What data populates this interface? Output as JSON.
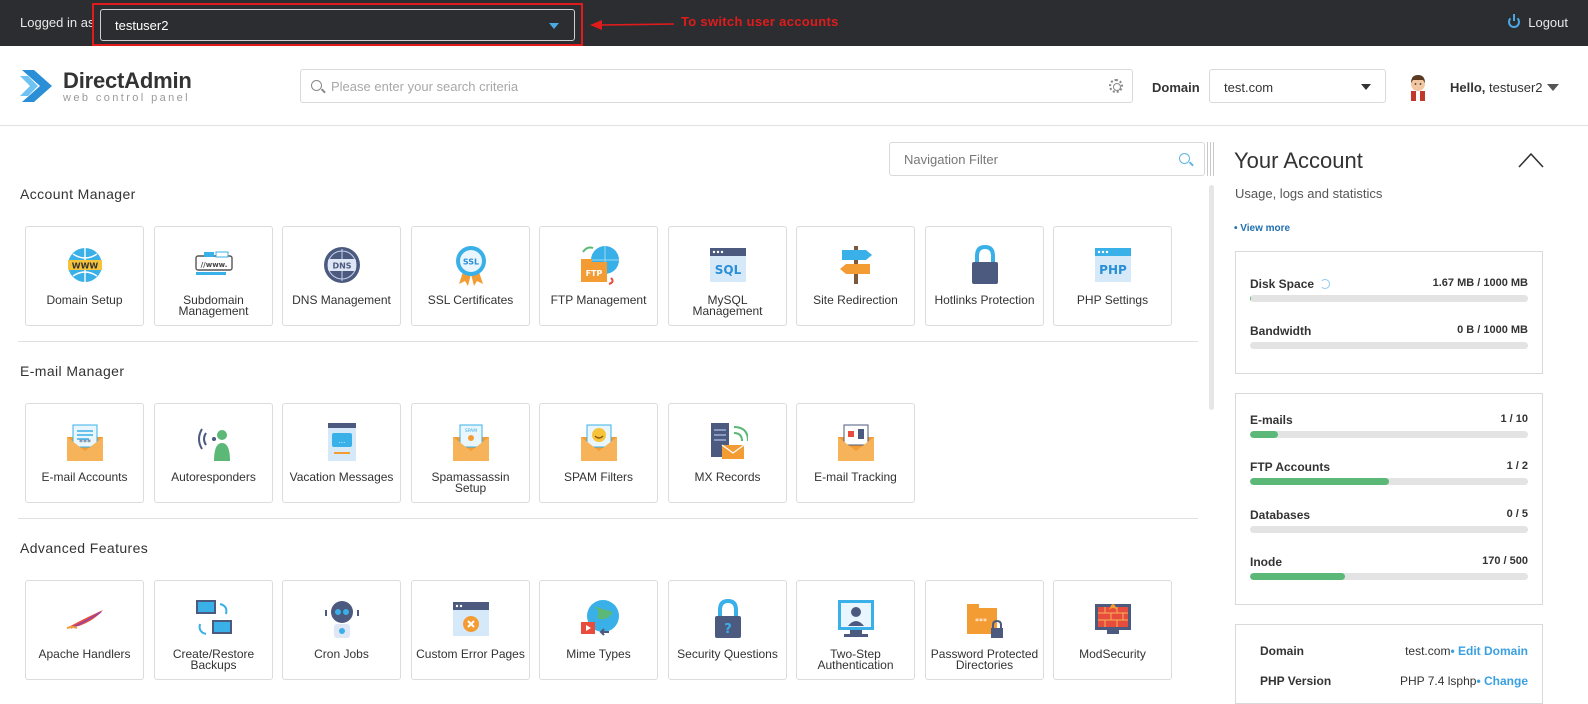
{
  "topbar": {
    "logged_in_as": "Logged in as",
    "user_select": "testuser2",
    "annotation": "To switch user accounts",
    "logout": "Logout"
  },
  "header": {
    "logo_title": "DirectAdmin",
    "logo_sub": "web control panel",
    "search_placeholder": "Please enter your search criteria",
    "domain_label": "Domain",
    "domain_value": "test.com",
    "hello_prefix": "Hello,",
    "hello_user": "testuser2"
  },
  "main": {
    "nav_filter_placeholder": "Navigation Filter",
    "sections": [
      {
        "title": "Account Manager",
        "tiles": [
          {
            "label": "Domain Setup",
            "icon": "www-globe-icon"
          },
          {
            "label": "Subdomain Management",
            "icon": "subdomain-icon"
          },
          {
            "label": "DNS Management",
            "icon": "dns-globe-icon"
          },
          {
            "label": "SSL Certificates",
            "icon": "ssl-badge-icon"
          },
          {
            "label": "FTP Management",
            "icon": "ftp-folder-icon"
          },
          {
            "label": "MySQL Management",
            "icon": "sql-window-icon"
          },
          {
            "label": "Site Redirection",
            "icon": "signpost-icon"
          },
          {
            "label": "Hotlinks Protection",
            "icon": "padlock-icon"
          },
          {
            "label": "PHP Settings",
            "icon": "php-window-icon"
          }
        ]
      },
      {
        "title": "E-mail Manager",
        "tiles": [
          {
            "label": "E-mail Accounts",
            "icon": "envelope-list-icon"
          },
          {
            "label": "Autoresponders",
            "icon": "broadcast-person-icon"
          },
          {
            "label": "Vacation Messages",
            "icon": "chat-document-icon"
          },
          {
            "label": "Spamassassin Setup",
            "icon": "spam-envelope-icon"
          },
          {
            "label": "SPAM Filters",
            "icon": "smiley-envelope-icon"
          },
          {
            "label": "MX Records",
            "icon": "mail-server-icon"
          },
          {
            "label": "E-mail Tracking",
            "icon": "tracking-envelope-icon"
          }
        ]
      },
      {
        "title": "Advanced Features",
        "tiles": [
          {
            "label": "Apache Handlers",
            "icon": "apache-feather-icon"
          },
          {
            "label": "Create/Restore Backups",
            "icon": "backup-monitors-icon"
          },
          {
            "label": "Cron Jobs",
            "icon": "robot-icon"
          },
          {
            "label": "Custom Error Pages",
            "icon": "error-window-icon"
          },
          {
            "label": "Mime Types",
            "icon": "mime-globe-icon"
          },
          {
            "label": "Security Questions",
            "icon": "question-lock-icon"
          },
          {
            "label": "Two-Step Authentication",
            "icon": "face-scan-icon"
          },
          {
            "label": "Password Protected Directories",
            "icon": "locked-folder-icon"
          },
          {
            "label": "ModSecurity",
            "icon": "firewall-monitor-icon"
          }
        ]
      }
    ]
  },
  "account": {
    "title": "Your Account",
    "subtitle": "Usage, logs and statistics",
    "view_more": "• View more",
    "usage": [
      {
        "name": "Disk Space",
        "value": "1.67 MB / 1000 MB",
        "fraction": 0.0017
      },
      {
        "name": "Bandwidth",
        "value": "0 B / 1000 MB",
        "fraction": 0
      }
    ],
    "limits": [
      {
        "name": "E-mails",
        "value": "1 / 10",
        "fraction": 0.1
      },
      {
        "name": "FTP Accounts",
        "value": "1 / 2",
        "fraction": 0.5
      },
      {
        "name": "Databases",
        "value": "0 / 5",
        "fraction": 0
      },
      {
        "name": "Inode",
        "value": "170 / 500",
        "fraction": 0.34
      }
    ],
    "info": [
      {
        "key": "Domain",
        "value": "test.com",
        "link": "• Edit Domain"
      },
      {
        "key": "PHP Version",
        "value": "PHP 7.4 lsphp",
        "link": "• Change"
      }
    ]
  },
  "colors": {
    "topbar_bg": "#2b2d31",
    "accent_blue": "#3aa0e0",
    "annotation_red": "#e11b1b",
    "progress_green": "#5cb877"
  }
}
